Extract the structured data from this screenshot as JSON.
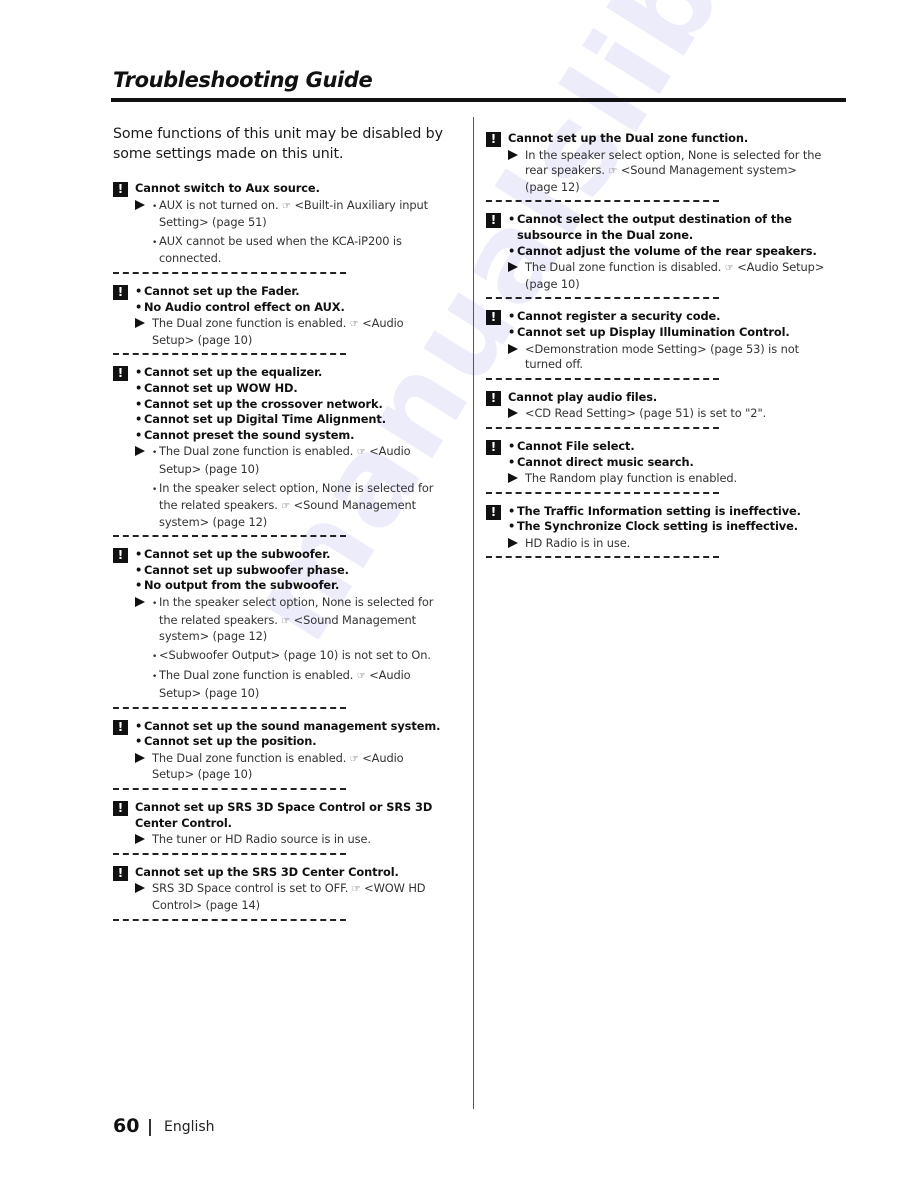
{
  "header": {
    "title": "Troubleshooting Guide"
  },
  "intro": "Some functions of this unit may be disabled by some settings made on this unit.",
  "icons": {
    "alert": "!",
    "arrow": "triangle-right",
    "reference": "☞"
  },
  "left_column": [
    {
      "problems": [
        {
          "text": "Cannot switch to Aux source.",
          "bulleted": false
        }
      ],
      "causes": [
        {
          "text": "AUX is not turned on. ",
          "ref": "<Built-in Auxiliary input Setting> (page 51)",
          "bulleted": true
        },
        {
          "text": "AUX cannot be used when the KCA-iP200 is connected.",
          "ref": "",
          "bulleted": true
        }
      ]
    },
    {
      "problems": [
        {
          "text": "Cannot set up the Fader.",
          "bulleted": true
        },
        {
          "text": "No Audio control effect on AUX.",
          "bulleted": true
        }
      ],
      "causes": [
        {
          "text": "The Dual zone function is enabled. ",
          "ref": "<Audio Setup> (page 10)",
          "bulleted": false
        }
      ]
    },
    {
      "problems": [
        {
          "text": "Cannot set up the equalizer.",
          "bulleted": true
        },
        {
          "text": "Cannot set up WOW HD.",
          "bulleted": true
        },
        {
          "text": "Cannot set up the crossover network.",
          "bulleted": true
        },
        {
          "text": "Cannot set up Digital Time Alignment.",
          "bulleted": true
        },
        {
          "text": "Cannot preset the sound system.",
          "bulleted": true
        }
      ],
      "causes": [
        {
          "text": "The Dual zone function is enabled. ",
          "ref": "<Audio Setup> (page 10)",
          "bulleted": true
        },
        {
          "text": "In the speaker select option, None is selected for the related speakers. ",
          "ref": "<Sound Management system> (page 12)",
          "bulleted": true
        }
      ]
    },
    {
      "problems": [
        {
          "text": "Cannot set up the subwoofer.",
          "bulleted": true
        },
        {
          "text": "Cannot set up subwoofer phase.",
          "bulleted": true
        },
        {
          "text": "No output from the subwoofer.",
          "bulleted": true
        }
      ],
      "causes": [
        {
          "text": "In the speaker select option, None is selected for the related speakers. ",
          "ref": "<Sound Management system> (page 12)",
          "bulleted": true
        },
        {
          "text": "<Subwoofer Output> (page 10) is not set to On.",
          "ref": "",
          "bulleted": true
        },
        {
          "text": "The Dual zone function is enabled. ",
          "ref": "<Audio Setup> (page 10)",
          "bulleted": true
        }
      ]
    },
    {
      "problems": [
        {
          "text": "Cannot set up the sound management system.",
          "bulleted": true
        },
        {
          "text": "Cannot set up the position.",
          "bulleted": true
        }
      ],
      "causes": [
        {
          "text": "The Dual zone function is enabled. ",
          "ref": "<Audio Setup> (page 10)",
          "bulleted": false
        }
      ]
    },
    {
      "problems": [
        {
          "text": "Cannot set up SRS 3D Space Control or SRS 3D Center Control.",
          "bulleted": false
        }
      ],
      "causes": [
        {
          "text": "The tuner or HD Radio source is in use.",
          "ref": "",
          "bulleted": false
        }
      ]
    },
    {
      "problems": [
        {
          "text": "Cannot set up the SRS 3D Center Control.",
          "bulleted": false
        }
      ],
      "causes": [
        {
          "text": "SRS 3D Space control is set to OFF. ",
          "ref": "<WOW HD Control> (page 14)",
          "bulleted": false
        }
      ]
    }
  ],
  "right_column": [
    {
      "problems": [
        {
          "text": "Cannot set up the Dual zone function.",
          "bulleted": false
        }
      ],
      "causes": [
        {
          "text": "In the speaker select option, None is selected for the rear speakers. ",
          "ref": "<Sound Management system> (page 12)",
          "bulleted": false
        }
      ]
    },
    {
      "problems": [
        {
          "text": "Cannot select the output destination of the subsource in the Dual zone.",
          "bulleted": true
        },
        {
          "text": "Cannot adjust the volume of the rear speakers.",
          "bulleted": true
        }
      ],
      "causes": [
        {
          "text": "The Dual zone function is disabled. ",
          "ref": "<Audio Setup> (page 10)",
          "bulleted": false
        }
      ]
    },
    {
      "problems": [
        {
          "text": "Cannot register a security code.",
          "bulleted": true
        },
        {
          "text": "Cannot set up Display Illumination Control.",
          "bulleted": true
        }
      ],
      "causes": [
        {
          "text": "<Demonstration mode Setting> (page 53) is not turned off.",
          "ref": "",
          "bulleted": false
        }
      ]
    },
    {
      "problems": [
        {
          "text": "Cannot play audio files.",
          "bulleted": false
        }
      ],
      "causes": [
        {
          "text": "<CD Read Setting> (page 51) is set to \"2\".",
          "ref": "",
          "bulleted": false
        }
      ]
    },
    {
      "problems": [
        {
          "text": "Cannot File select.",
          "bulleted": true
        },
        {
          "text": "Cannot direct music search.",
          "bulleted": true
        }
      ],
      "causes": [
        {
          "text": "The Random play function is enabled.",
          "ref": "",
          "bulleted": false
        }
      ]
    },
    {
      "problems": [
        {
          "text": "The Traffic Information setting is ineffective.",
          "bulleted": true
        },
        {
          "text": "The Synchronize Clock setting is ineffective.",
          "bulleted": true
        }
      ],
      "causes": [
        {
          "text": "HD Radio is in use.",
          "ref": "",
          "bulleted": false
        }
      ]
    }
  ],
  "footer": {
    "page_number": "60",
    "language": "English"
  },
  "watermark": "manualslib.com"
}
